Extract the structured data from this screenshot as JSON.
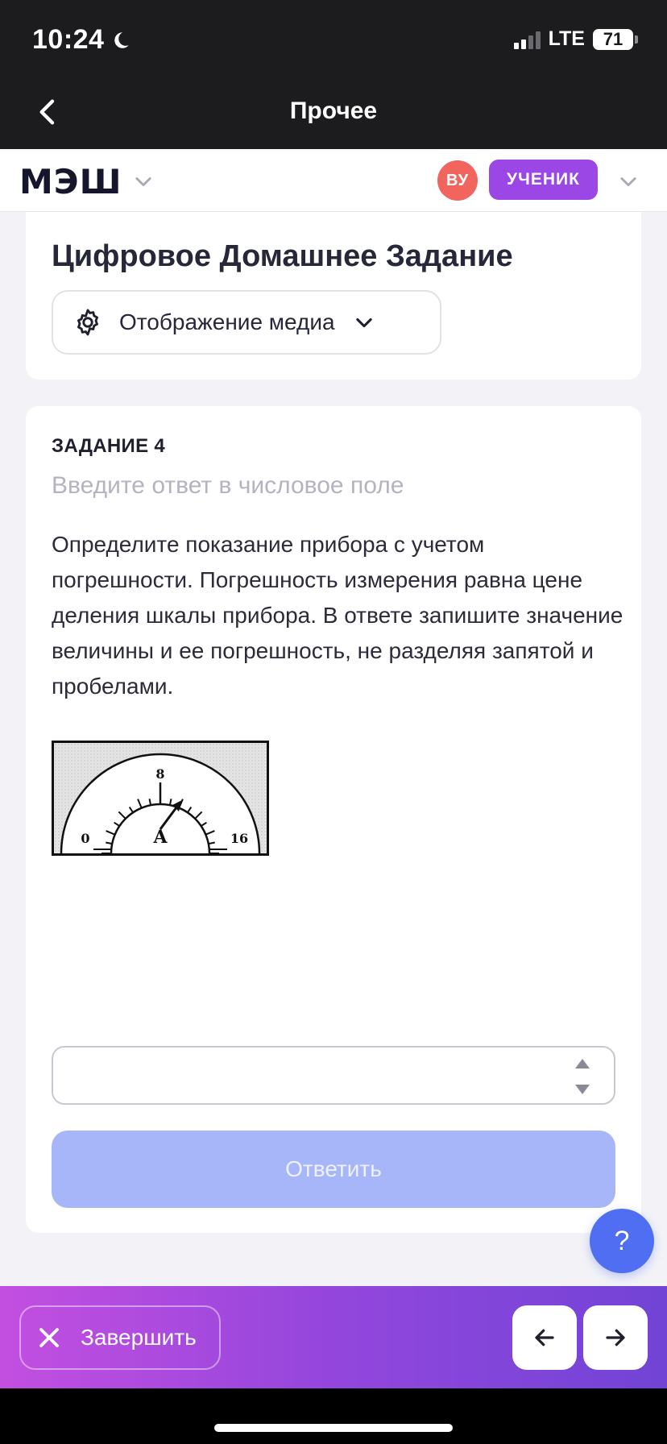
{
  "status_bar": {
    "time": "10:24",
    "network": "LTE",
    "battery": "71",
    "battery_level": 0.71
  },
  "nav": {
    "title": "Прочее"
  },
  "header": {
    "logo": "МЭШ",
    "avatar_initials": "ВУ",
    "role": "УЧЕНИК"
  },
  "top_card": {
    "title": "Цифровое Домашнее Задание",
    "media_label": "Отображение медиа"
  },
  "task": {
    "number_label": "ЗАДАНИЕ 4",
    "hint": "Введите ответ в числовое поле",
    "text": "Определите показание прибора с учетом погрешности. Погрешность измерения равна цене деления шкалы прибора. В ответе запишите значение величины и ее погрешность, не разделяя запятой и пробелами.",
    "figure": {
      "label_min": "0",
      "label_mid": "8",
      "label_max": "16",
      "unit_letter": "A"
    },
    "answer_value": "",
    "submit_label": "Ответить"
  },
  "help": {
    "label": "?"
  },
  "bottom_bar": {
    "finish_label": "Завершить"
  },
  "colors": {
    "accent": "#4f6ef2",
    "role_badge": "#9a47e6",
    "avatar": "#f2645e",
    "submit_disabled": "#a6b6f8"
  }
}
